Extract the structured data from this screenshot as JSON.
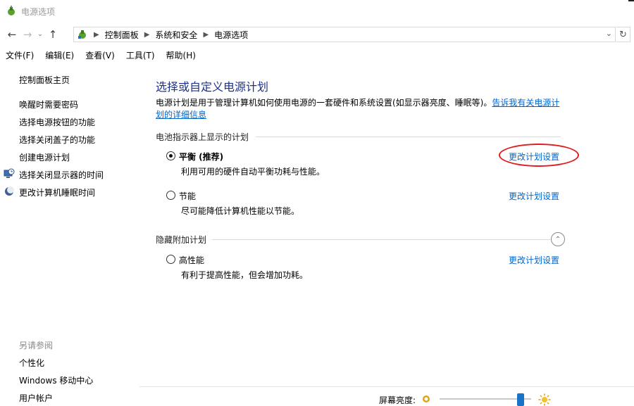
{
  "window": {
    "title": "电源选项"
  },
  "nav": {
    "breadcrumb": [
      "控制面板",
      "系统和安全",
      "电源选项"
    ]
  },
  "menu": [
    "文件(F)",
    "编辑(E)",
    "查看(V)",
    "工具(T)",
    "帮助(H)"
  ],
  "sidebar": {
    "home": "控制面板主页",
    "items": [
      {
        "label": "唤醒时需要密码"
      },
      {
        "label": "选择电源按钮的功能"
      },
      {
        "label": "选择关闭盖子的功能"
      },
      {
        "label": "创建电源计划"
      },
      {
        "label": "选择关闭显示器的时间",
        "icon": "monitor-clock-icon"
      },
      {
        "label": "更改计算机睡眠时间",
        "icon": "moon-icon"
      }
    ],
    "see_also": {
      "title": "另请参阅",
      "items": [
        "个性化",
        "Windows 移动中心",
        "用户帐户"
      ]
    }
  },
  "main": {
    "title": "选择或自定义电源计划",
    "description_line1": "电源计划是用于管理计算机如何使用电源的一套硬件和系统设置(如显示器亮度、睡眠等)。",
    "description_link_part1": "告诉我有关电源计",
    "description_link_part2": "划的详细信息",
    "battery_section_title": "电池指示器上显示的计划",
    "hidden_section_title": "隐藏附加计划",
    "plans": [
      {
        "name": "平衡 (推荐)",
        "desc": "利用可用的硬件自动平衡功耗与性能。",
        "link": "更改计划设置",
        "selected": true
      },
      {
        "name": "节能",
        "desc": "尽可能降低计算机性能以节能。",
        "link": "更改计划设置",
        "selected": false
      }
    ],
    "hidden_plans": [
      {
        "name": "高性能",
        "desc": "有利于提高性能，但会增加功耗。",
        "link": "更改计划设置",
        "selected": false
      }
    ]
  },
  "brightness": {
    "label": "屏幕亮度:",
    "level": 0.92
  },
  "colors": {
    "accent": "#0066cc",
    "title": "#1e3287",
    "annotation": "#e01e1e"
  }
}
